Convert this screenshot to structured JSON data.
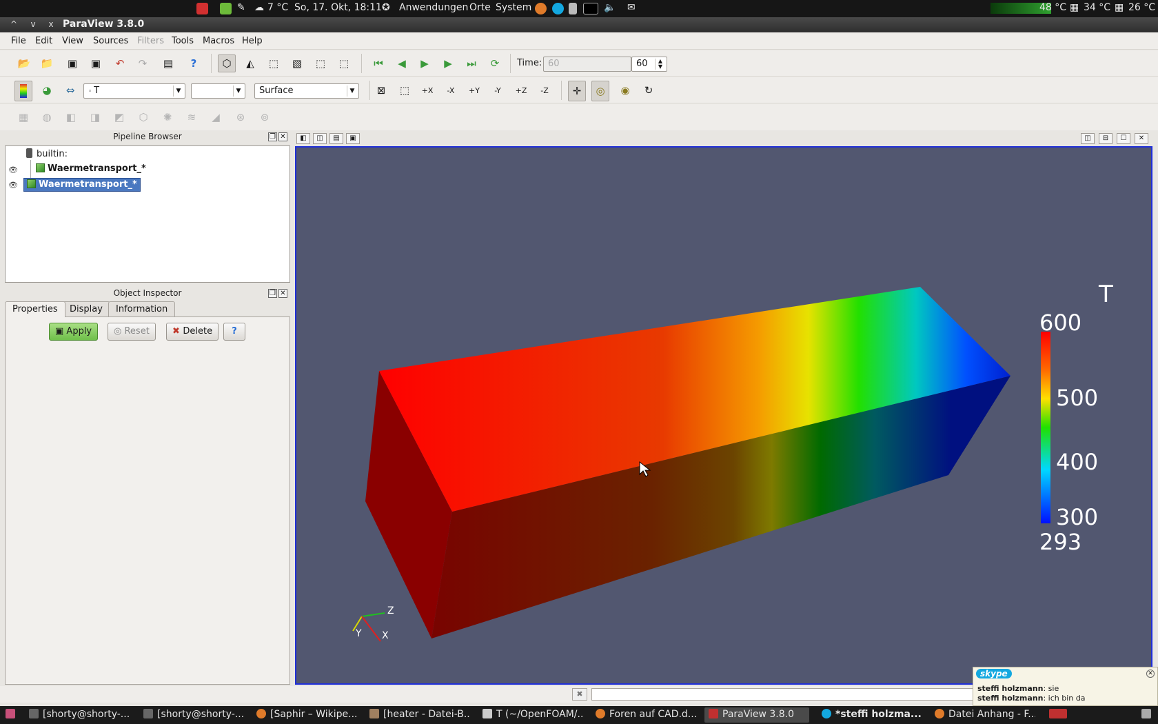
{
  "top_panel": {
    "weather": "7 °C",
    "datetime": "So, 17. Okt, 18:11",
    "menus": [
      "Anwendungen",
      "Orte",
      "System"
    ],
    "temps": [
      "48 °C",
      "34 °C",
      "26 °C"
    ]
  },
  "window": {
    "title": "ParaView 3.8.0",
    "controls": [
      "^",
      "v",
      "x"
    ]
  },
  "menubar": [
    "File",
    "Edit",
    "View",
    "Sources",
    "Filters",
    "Tools",
    "Macros",
    "Help"
  ],
  "toolbar": {
    "time_label": "Time:",
    "time_value": "60",
    "time_step": "60",
    "color_by": "T",
    "representation": "Surface",
    "color_component": ""
  },
  "pipeline": {
    "title": "Pipeline Browser",
    "items": [
      {
        "label": "builtin:"
      },
      {
        "label": "Waermetransport_*"
      },
      {
        "label": "Waermetransport_*"
      }
    ]
  },
  "inspector": {
    "title": "Object Inspector",
    "tabs": [
      "Properties",
      "Display",
      "Information"
    ],
    "apply": "Apply",
    "reset": "Reset",
    "delete": "Delete",
    "help": "?"
  },
  "scalar_bar": {
    "title": "T",
    "labels": [
      "600",
      "500",
      "400",
      "300",
      "293"
    ],
    "range": [
      293,
      600
    ]
  },
  "axes": {
    "x": "X",
    "y": "Y",
    "z": "Z"
  },
  "skype": {
    "brand": "skype",
    "messages": [
      {
        "sender": "steffi holzmann",
        "text": ": sie"
      },
      {
        "sender": "steffi holzmann",
        "text": ": ich bin da"
      }
    ]
  },
  "taskbar": [
    {
      "label": "[shorty@shorty-...",
      "color": "#666666"
    },
    {
      "label": "[shorty@shorty-...",
      "color": "#666666"
    },
    {
      "label": "[Saphir – Wikipe...",
      "color": "#e07b2a"
    },
    {
      "label": "[heater - Datei-B...",
      "color": "#a08060"
    },
    {
      "label": "T (~/OpenFOAM/...",
      "color": "#cccccc"
    },
    {
      "label": "Foren auf CAD.d...",
      "color": "#e07b2a"
    },
    {
      "label": "ParaView 3.8.0",
      "color": "#c03030"
    },
    {
      "label": "*steffi holzma...",
      "color": "#13a8e0"
    },
    {
      "label": "Datei Anhang - F...",
      "color": "#e07b2a"
    }
  ],
  "colors": {
    "view_bg": "#525770",
    "view_border": "#1f2fd8",
    "selection": "#4a78c0"
  }
}
